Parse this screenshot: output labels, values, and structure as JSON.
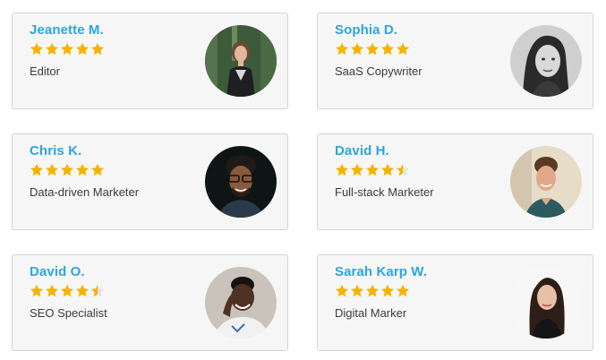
{
  "colors": {
    "name": "#2ba6de",
    "star": "#f5b301",
    "star_empty": "#e3e3e3"
  },
  "reviewers": [
    {
      "name": "Jeanette M.",
      "role": "Editor",
      "rating": 5,
      "avatar_icon": "woman-portrait-icon"
    },
    {
      "name": "Sophia D.",
      "role": "SaaS Copywriter",
      "rating": 5,
      "avatar_icon": "woman-portrait-icon"
    },
    {
      "name": "Chris K.",
      "role": "Data-driven Marketer",
      "rating": 5,
      "avatar_icon": "man-portrait-icon"
    },
    {
      "name": "David H.",
      "role": "Full-stack Marketer",
      "rating": 4.5,
      "avatar_icon": "man-portrait-icon"
    },
    {
      "name": "David O.",
      "role": "SEO Specialist",
      "rating": 4.5,
      "avatar_icon": "man-portrait-icon"
    },
    {
      "name": "Sarah Karp W.",
      "role": "Digital Marker",
      "rating": 5,
      "avatar_icon": "woman-portrait-icon"
    }
  ]
}
